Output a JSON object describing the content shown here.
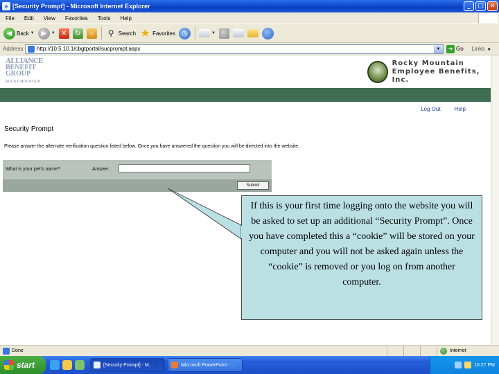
{
  "window": {
    "title": "[Security Prompt] - Microsoft Internet Explorer",
    "minimize": "_",
    "maximize": "□",
    "close": "✕"
  },
  "menu": [
    "File",
    "Edit",
    "View",
    "Favorites",
    "Tools",
    "Help"
  ],
  "toolbar": {
    "back_label": "Back",
    "search_label": "Search",
    "favorites_label": "Favorites"
  },
  "address": {
    "label": "Address",
    "url": "http://10.5.10.1/cbgtportal/sucprompt.aspx",
    "go_label": "Go",
    "links_label": "Links"
  },
  "page": {
    "alliance_logo": [
      "ALLIANCE",
      "BENEFIT",
      "GROUP",
      "ROCKY MOUNTAIN"
    ],
    "rocky_logo": [
      "Rocky Mountain",
      "Employee Benefits, Inc."
    ],
    "nav": {
      "logout": "Log Out",
      "help": "Help"
    },
    "title": "Security Prompt",
    "instructions": "Please answer the alternate verification question listed below. Once you have answered the question you will be directed into the website.",
    "question": "What is your pet's name?",
    "answer_label": "Answer:",
    "answer_value": "",
    "submit_label": "Submit"
  },
  "callout": {
    "text": "If this is your first time logging onto the website you will be asked to set up an additional “Security Prompt”.  Once you have completed this a “cookie” will be stored on your computer and you will not be asked again unless the “cookie” is removed or you log on from another computer."
  },
  "status": {
    "text": "Done",
    "zone": "Internet"
  },
  "taskbar": {
    "start_label": "start",
    "items": [
      "[Security Prompt] - M...",
      "Microsoft PowerPoint - ..."
    ],
    "clock": "10:27 PM"
  },
  "colors": {
    "header_band": "#3f6e53",
    "callout_fill": "#bbe0e3",
    "link_blue": "#1d3f9c"
  }
}
